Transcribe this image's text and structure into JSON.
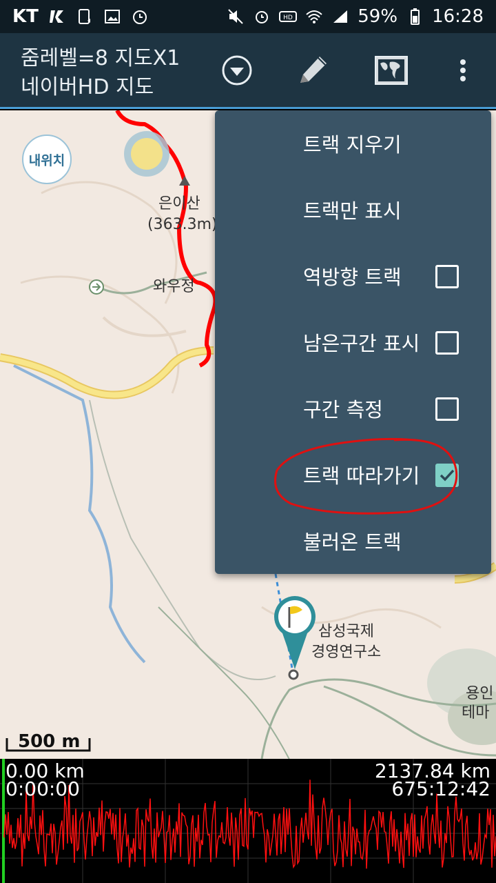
{
  "status_bar": {
    "carrier": "KT",
    "battery": "59%",
    "time": "16:28",
    "icons_left": [
      "carrier-signal-icon",
      "sim-icon",
      "image-icon",
      "alarm-clock-icon"
    ],
    "icons_right": [
      "mute-icon",
      "alarm-icon",
      "hd-voice-icon",
      "wifi-icon",
      "signal-bars-icon",
      "battery-icon"
    ]
  },
  "app_bar": {
    "title_line1": "줌레벨=8 지도X1",
    "title_line2": "네이버HD 지도",
    "buttons": [
      "dropdown-circle-icon",
      "pencil-icon",
      "world-map-icon",
      "more-vert-icon"
    ]
  },
  "map": {
    "my_location_label": "내위치",
    "labels": {
      "mountain": "은이산",
      "elevation": "(363.3m)",
      "place_wau": "와우정",
      "samsung_1": "삼성국제",
      "samsung_2": "경영연구소",
      "yongin_1": "용인",
      "yongin_2": "테마"
    },
    "scale": "500 m"
  },
  "menu": {
    "items": [
      {
        "label": "트랙 지우기",
        "checkbox": false
      },
      {
        "label": "트랙만 표시",
        "checkbox": false
      },
      {
        "label": "역방향 트랙",
        "checkbox": true,
        "checked": false
      },
      {
        "label": "남은구간 표시",
        "checkbox": true,
        "checked": false
      },
      {
        "label": "구간 측정",
        "checkbox": true,
        "checked": false
      },
      {
        "label": "트랙 따라가기",
        "checkbox": true,
        "checked": true
      },
      {
        "label": "불러온 트랙",
        "checkbox": false
      }
    ]
  },
  "graph": {
    "start_distance": "0.00 km",
    "start_time": "0:00:00",
    "total_distance": "2137.84 km",
    "total_time": "675:12:42"
  },
  "colors": {
    "app_bar": "#1e3442",
    "menu_bg": "#3a5466",
    "track": "#ff0000",
    "checked": "#7fd0c6"
  }
}
